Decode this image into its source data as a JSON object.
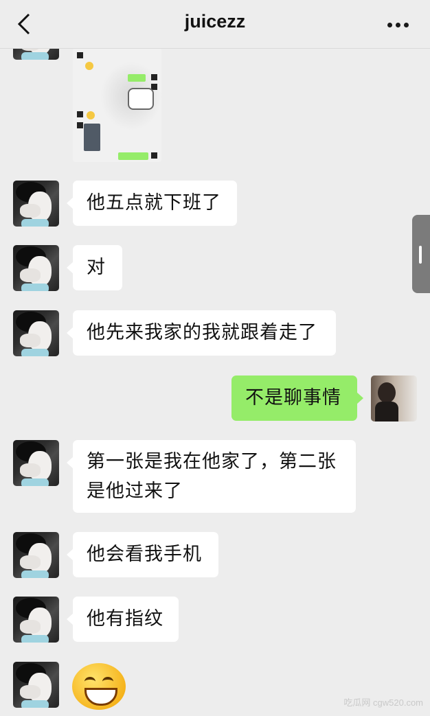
{
  "header": {
    "title": "juicezz"
  },
  "messages": [
    {
      "from": "them",
      "text": "他五点就下班了"
    },
    {
      "from": "them",
      "text": "对"
    },
    {
      "from": "them",
      "text": "他先来我家的我就跟着走了"
    },
    {
      "from": "me",
      "text": "不是聊事情"
    },
    {
      "from": "them",
      "line1": "第一张是我在他家了，第二张",
      "line2": "是他过来了"
    },
    {
      "from": "them",
      "text": "他会看我手机"
    },
    {
      "from": "them",
      "text": "他有指纹"
    },
    {
      "from": "them",
      "emoji": "grinning-face-emoji"
    }
  ],
  "watermark": "吃瓜网 cgw520.com",
  "colors": {
    "background": "#ededed",
    "self_bubble": "#95ec69",
    "other_bubble": "#ffffff"
  }
}
